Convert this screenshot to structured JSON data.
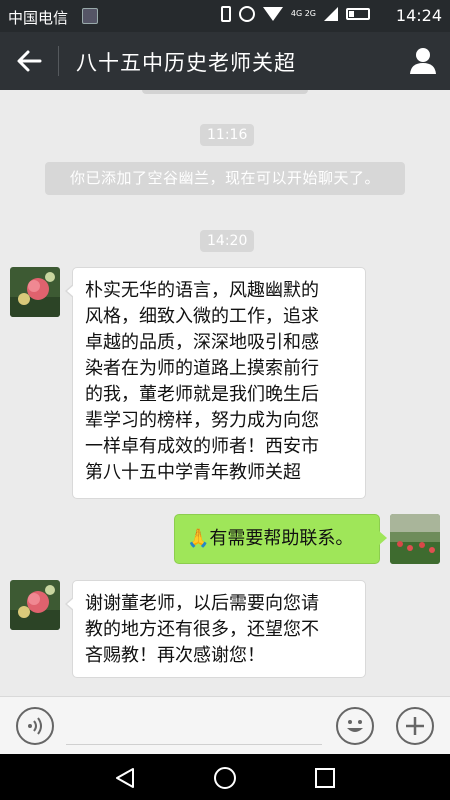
{
  "status_bar": {
    "carrier": "中国电信",
    "network": "4G 2G",
    "time": "14:24",
    "icons": [
      "image-icon",
      "vibrate-icon",
      "alarm-icon",
      "wifi-icon",
      "signal-icon",
      "battery-icon"
    ]
  },
  "header": {
    "title": "八十五中历史老师关超",
    "back_icon": "arrow-left-icon",
    "profile_icon": "person-icon"
  },
  "chat": {
    "timestamps": [
      "11:16",
      "14:20"
    ],
    "system_message": "你已添加了空谷幽兰，现在可以开始聊天了。",
    "messages": [
      {
        "side": "left",
        "lines": [
          "朴实无华的语言，风趣幽默的",
          "风格，细致入微的工作，追求",
          "卓越的品质，深深地吸引和感",
          "染者在为师的道路上摸索前行",
          "的我，董老师就是我们晚生后",
          "辈学习的榜样，努力成为向您",
          "一样卓有成效的师者！西安市",
          "第八十五中学青年教师关超"
        ]
      },
      {
        "side": "right",
        "text": "🙏有需要帮助联系。"
      },
      {
        "side": "left",
        "lines": [
          "谢谢董老师，以后需要向您请",
          "教的地方还有很多，还望您不",
          "吝赐教！再次感谢您！"
        ]
      }
    ]
  },
  "input_bar": {
    "voice_icon": "voice-icon",
    "emoji_icon": "emoji-icon",
    "plus_icon": "plus-icon"
  },
  "nav_bar": {
    "icons": [
      "back-triangle-icon",
      "home-circle-icon",
      "recents-square-icon"
    ]
  },
  "colors": {
    "header_bg": "#2e3236",
    "chat_bg": "#ebebeb",
    "bubble_sent": "#9fe659",
    "bubble_received": "#ffffff"
  }
}
